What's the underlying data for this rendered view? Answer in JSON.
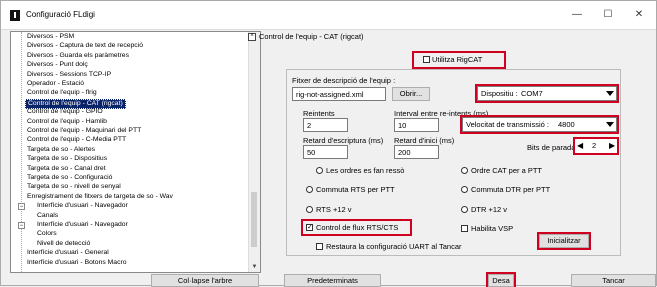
{
  "window": {
    "title": "Configuració FLdigi",
    "minimize_glyph": "—",
    "maximize_glyph": "☐",
    "close_glyph": "✕"
  },
  "tree": {
    "items": [
      {
        "label": "Diversos - PSM",
        "depth": 2
      },
      {
        "label": "Diversos - Captura de text de recepció",
        "depth": 2
      },
      {
        "label": "Diversos - Guarda els paràmetres",
        "depth": 2
      },
      {
        "label": "Diversos - Punt dolç",
        "depth": 2
      },
      {
        "label": "Diversos - Sessions TCP-IP",
        "depth": 2
      },
      {
        "label": "Operador - Estació",
        "depth": 2
      },
      {
        "label": "Control de l'equip - flrig",
        "depth": 2
      },
      {
        "label": "Control de l'equip - CAT (rigcat)",
        "depth": 2,
        "selected": true
      },
      {
        "label": "Control de l'equip - GPIO",
        "depth": 2
      },
      {
        "label": "Control de l'equip - Hamlib",
        "depth": 2
      },
      {
        "label": "Control de l'equip - Maquinari del PTT",
        "depth": 2
      },
      {
        "label": "Control de l'equip - C-Media PTT",
        "depth": 2
      },
      {
        "label": "Targeta de so - Alertes",
        "depth": 2
      },
      {
        "label": "Targeta de so - Dispositius",
        "depth": 2
      },
      {
        "label": "Targeta de so - Canal dret",
        "depth": 2
      },
      {
        "label": "Targeta de so - Configuració",
        "depth": 2
      },
      {
        "label": "Targeta de so - nivell de senyal",
        "depth": 2
      },
      {
        "label": "Enregistrament de fitxers de targeta de so - Wav",
        "depth": 2
      },
      {
        "label": "Interfície d'usuari - Navegador",
        "depth": 1,
        "expander": "−"
      },
      {
        "label": "Canals",
        "depth": 3
      },
      {
        "label": "Interfície d'usuari - Navegador",
        "depth": 1,
        "expander": "−"
      },
      {
        "label": "Colors",
        "depth": 3
      },
      {
        "label": "Nivell de detecció",
        "depth": 3
      },
      {
        "label": "Interfície d'usuari - General",
        "depth": 2
      },
      {
        "label": "Interfície d'usuari - Botons Macro",
        "depth": 2
      }
    ],
    "collapse_button": "Col·lapse l'arbre"
  },
  "panel": {
    "header": "Control de l'equip - CAT (rigcat)",
    "collapse_glyph": "^",
    "use_rigcat_label": "Utilitza RigCAT",
    "desc_file_label": "Fitxer de descripció de l'equip :",
    "desc_file_value": "rig-not-assigned.xml",
    "open_button": "Obrir...",
    "device_label": "Dispositiu :",
    "device_value": "COM7",
    "retries_label": "Reintents",
    "retries_value": "2",
    "retry_interval_label": "Interval entre re-intents (ms)",
    "retry_interval_value": "10",
    "baud_label": "Velocitat de transmissió :",
    "baud_value": "4800",
    "write_delay_label": "Retard d'escriptura (ms)",
    "write_delay_value": "50",
    "init_delay_label": "Retard d'inici (ms)",
    "init_delay_value": "200",
    "stopbits_label": "Bits de parada",
    "stopbits_value": "2",
    "opt_echo": "Les ordres es fan ressò",
    "opt_cat_ptt": "Ordre CAT per a PTT",
    "opt_rts_ptt": "Commuta RTS per PTT",
    "opt_dtr_ptt": "Commuta DTR per PTT",
    "opt_rts12": "RTS +12 v",
    "opt_dtr12": "DTR +12 v",
    "opt_flow": "Control de flux RTS/CTS",
    "opt_vsp": "Habilita VSP",
    "opt_restore": "Restaura la configuració UART al Tancar",
    "init_button": "Inicialitzar"
  },
  "footer": {
    "defaults_button": "Predeterminats",
    "save_button": "Desa",
    "cancel_button": "Tancar"
  },
  "colors": {
    "highlight": "#d00020",
    "selection": "#0a246a"
  }
}
